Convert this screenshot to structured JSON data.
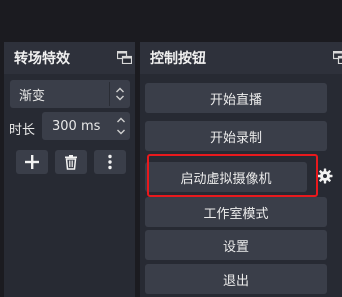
{
  "transitions_panel": {
    "title": "转场特效",
    "transition_select": {
      "value": "渐变"
    },
    "duration": {
      "label": "时长",
      "value": "300 ms"
    },
    "tools": {
      "add_icon": "plus-icon",
      "remove_icon": "trash-icon",
      "more_icon": "vertical-dots-icon"
    }
  },
  "controls_panel": {
    "title": "控制按钮",
    "buttons": {
      "start_streaming": "开始直播",
      "start_recording": "开始录制",
      "start_virtual_camera": "启动虚拟摄像机",
      "studio_mode": "工作室模式",
      "settings": "设置",
      "exit": "退出"
    },
    "vcam_settings_icon": "gear-icon"
  },
  "colors": {
    "background": "#1b1b20",
    "panel": "#272a33",
    "button": "#3a3e49",
    "highlight_annotation": "#e8191d"
  }
}
